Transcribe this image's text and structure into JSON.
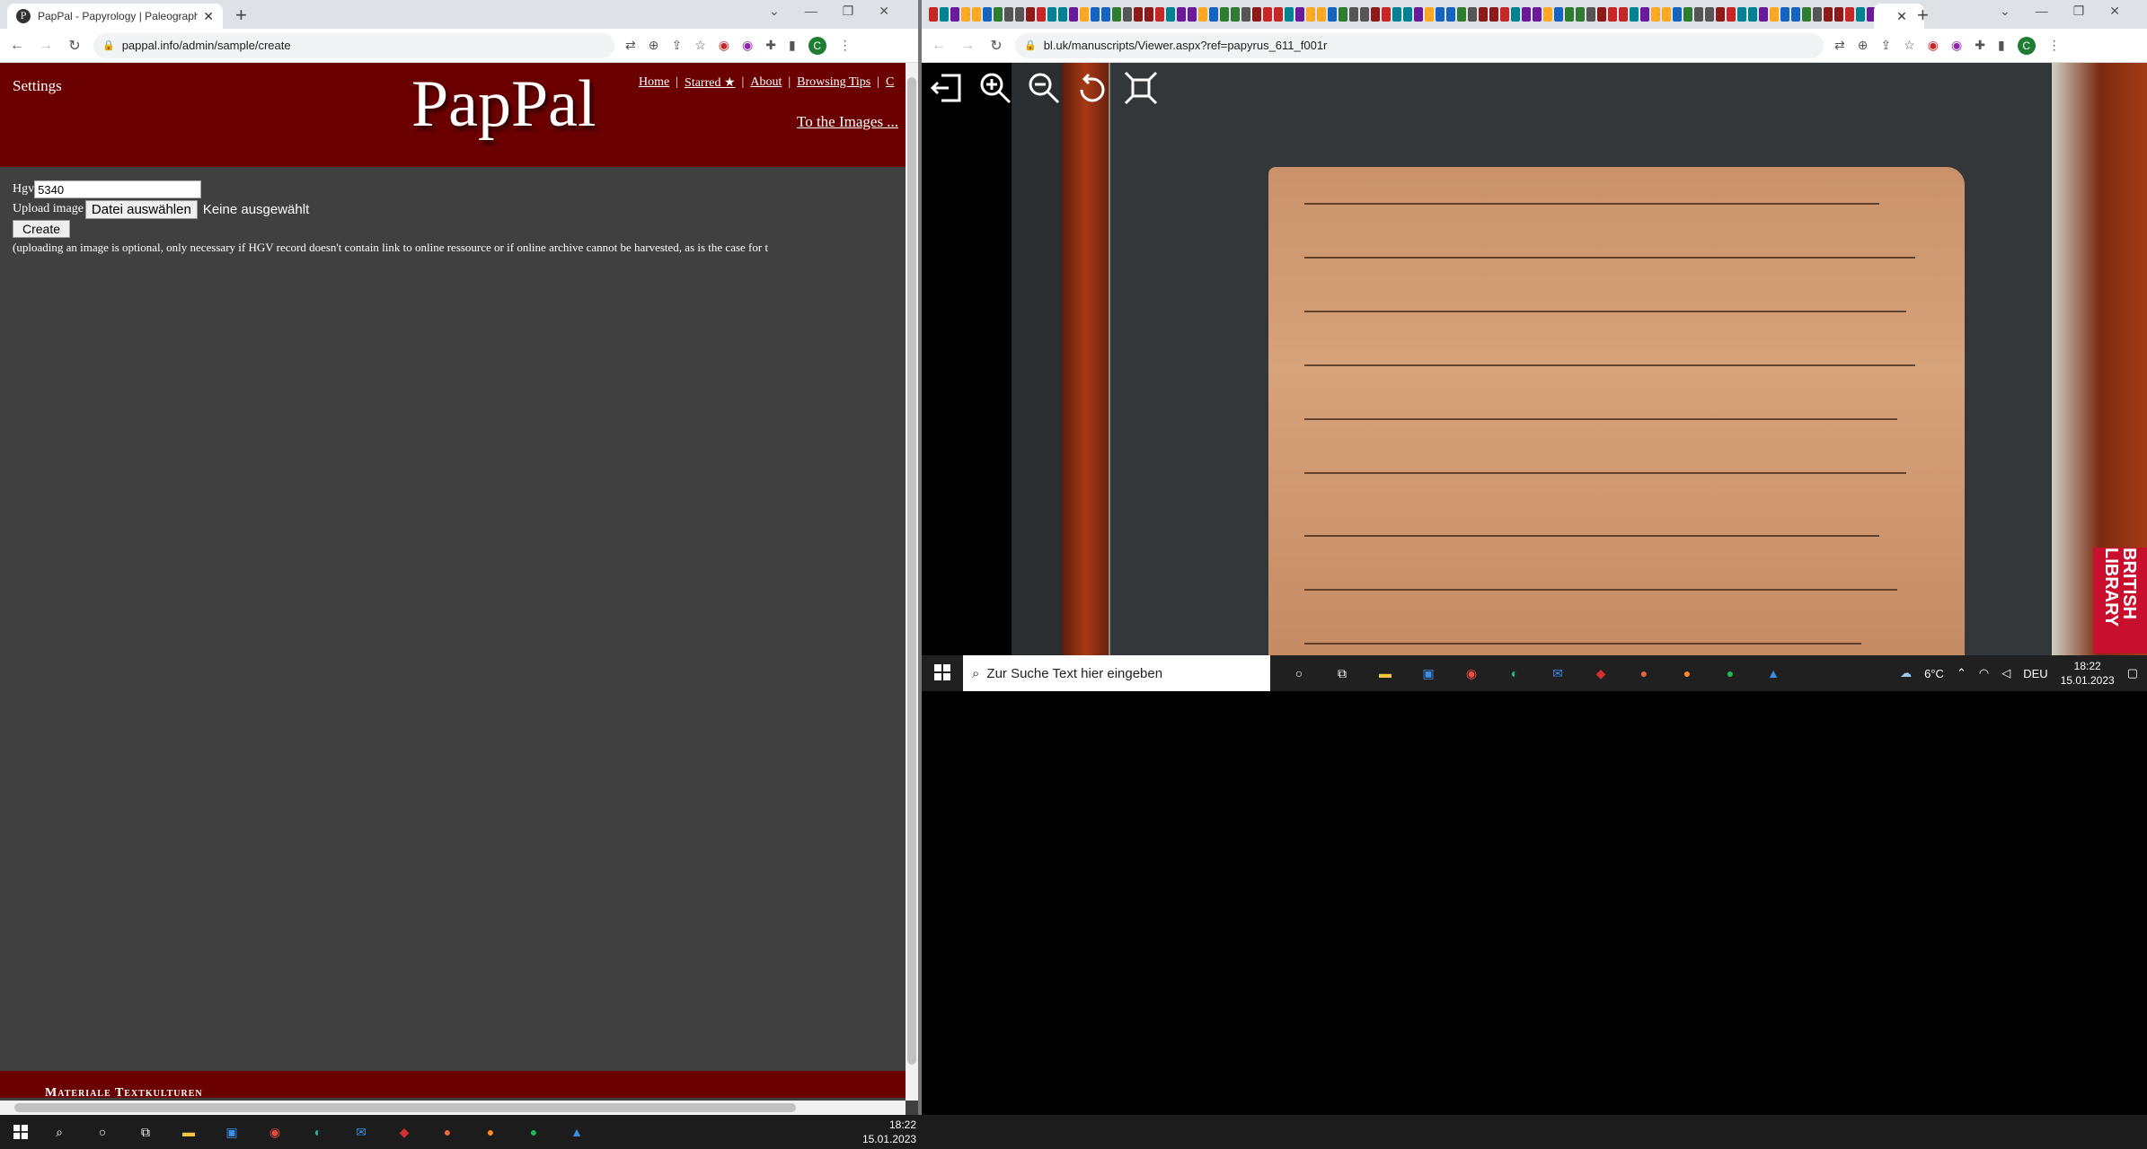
{
  "left_browser": {
    "tab_title": "PapPal - Papyrology | Paleograph",
    "favicon_letter": "P",
    "url": "pappal.info/admin/sample/create",
    "profile_letter": "C"
  },
  "pappal": {
    "settings": "Settings",
    "logo": "PapPal",
    "nav": [
      "Home",
      "Starred ★",
      "About",
      "Browsing Tips",
      "C"
    ],
    "to_images": "To the Images ...",
    "form": {
      "hgv_label": "Hgv",
      "hgv_value": "5340",
      "upload_label": "Upload image",
      "choose_file": "Datei auswählen",
      "no_file": "Keine ausgewählt",
      "create": "Create",
      "note": "(uploading an image is optional, only necessary if HGV record doesn't contain link to online ressource or if online archive cannot be harvested, as is the case for t"
    },
    "footer": "Materiale Textkulturen"
  },
  "right_browser": {
    "url": "bl.uk/manuscripts/Viewer.aspx?ref=papyrus_611_f001r",
    "profile_letter": "C",
    "viewer_tools": [
      "exit-icon",
      "zoom-in-icon",
      "zoom-out-icon",
      "rotate-icon",
      "fit-icon"
    ],
    "logo_text": "BRITISH LIBRARY",
    "mini_taskbar": {
      "search_placeholder": "Zur Suche Text hier eingeben",
      "weather": "6°C",
      "lang": "DEU",
      "time": "18:22",
      "date": "15.01.2023"
    }
  },
  "taskbar": {
    "time": "18:22",
    "date": "15.01.2023"
  },
  "colors": {
    "header": "#6b0000",
    "page_bg": "#404040"
  }
}
